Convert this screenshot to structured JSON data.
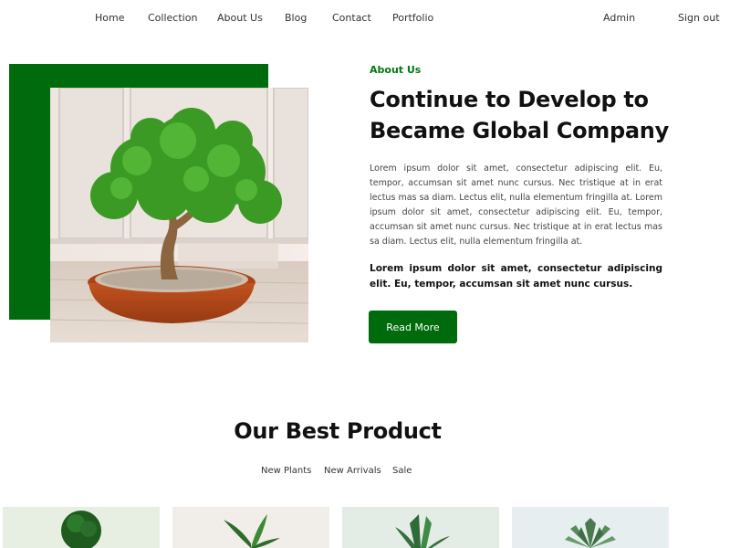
{
  "nav": {
    "home": "Home",
    "collection": "Collection",
    "about": "About Us",
    "blog": "Blog",
    "contact": "Contact",
    "portfolio": "Portfolio",
    "admin": "Admin",
    "signout": "Sign out"
  },
  "hero": {
    "eyebrow": "About Us",
    "title": "Continue to Develop to Became Global Company",
    "body": "Lorem ipsum dolor sit amet, consectetur adipiscing elit. Eu, tempor, accumsan sit amet nunc cursus. Nec tristique at in erat lectus mas sa diam. Lectus elit, nulla elementum fringilla at. Lorem ipsum dolor sit amet, consectetur adipiscing elit. Eu, tempor, accumsan sit amet nunc cursus. Nec tristique at in erat lectus mas sa diam. Lectus elit, nulla elementum fringilla at.",
    "bold": "Lorem ipsum dolor sit amet, consectetur adipiscing elit. Eu, tempor, accumsan sit amet nunc cursus.",
    "button": "Read More",
    "image_icon": "bonsai-tree-image"
  },
  "products": {
    "title": "Our Best Product",
    "tabs": [
      "New Plants",
      "New Arrivals",
      "Sale"
    ],
    "cards": [
      {
        "icon": "topiary-plant-image",
        "background": "#e6efe2"
      },
      {
        "icon": "leafy-plant-image",
        "background": "#f1ede8"
      },
      {
        "icon": "snake-plant-image",
        "background": "#e3ede6"
      },
      {
        "icon": "succulent-plant-image",
        "background": "#e6eef0"
      }
    ]
  },
  "colors": {
    "brand_green": "#006b0c",
    "accent_text_green": "#007a10"
  }
}
